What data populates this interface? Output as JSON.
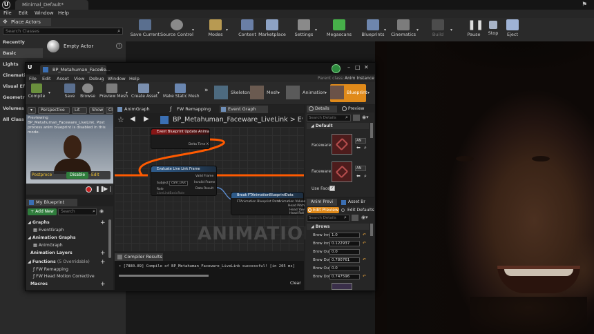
{
  "editor": {
    "level_tab": "Minimal_Default*",
    "menu": [
      "File",
      "Edit",
      "Window",
      "Help"
    ]
  },
  "place_actors": {
    "tab_label": "Place Actors",
    "search_placeholder": "Search Classes",
    "categories": [
      "Recently Placed",
      "Basic",
      "Lights",
      "Cinematic",
      "Visual Eff",
      "Geometry",
      "Volumes",
      "All Class"
    ],
    "selected_category": "Basic",
    "item_label": "Empty Actor"
  },
  "toolbar": {
    "buttons": [
      "Save Current",
      "Source Control",
      "Modes",
      "Content",
      "Marketplace",
      "Settings",
      "Megascans",
      "Blueprints",
      "Cinematics",
      "Build",
      "Pause",
      "Stop",
      "Eject"
    ]
  },
  "blueprint": {
    "tab_title": "BP_Metahuman_Facewe...",
    "menu": [
      "File",
      "Edit",
      "Asset",
      "View",
      "Debug",
      "Window",
      "Help"
    ],
    "parent_class_label": "Parent class:",
    "parent_class_value": "Anim Instance",
    "toolbar": {
      "buttons": [
        "Compile",
        "Save",
        "Browse",
        "Preview Mesh",
        "Create Asset",
        "Make Static Mesh"
      ],
      "modes": [
        "Skeleton",
        "Mesh",
        "Animation",
        "Blueprint"
      ],
      "more": "»"
    },
    "viewport": {
      "perspective": "Perspective",
      "lit": "Lit",
      "show": "Show",
      "overflow": "Cli",
      "warning": "Previewing BP_Metahuman_Faceware_LiveLink. Post process anim blueprint is disabled in this mode.",
      "postprocess": "Postproce",
      "disable": "Disable",
      "edit": "Edit"
    },
    "my_blueprint": {
      "tab_label": "My Blueprint",
      "add_new": "+ Add New",
      "search_placeholder": "Search",
      "sections": {
        "graphs": "Graphs",
        "event_graph": "EventGraph",
        "animation_graphs": "Animation Graphs",
        "anim_graph": "AnimGraph",
        "animation_layers": "Animation Layers",
        "functions": "Functions",
        "functions_overridable": "(5 Overridable)",
        "fn_1": "FW Remapping",
        "fn_2": "FW Head Motion Corrective",
        "macros": "Macros"
      }
    },
    "graph_tabs": [
      "AnimGraph",
      "FW Remapping",
      "Event Graph"
    ],
    "breadcrumb": "BP_Metahuman_Faceware_LiveLink  >  Event Graph",
    "nodes": {
      "n1_title": "Event Blueprint Update Animation",
      "n1_pin": "Delta Time X",
      "n2_title": "Evaluate Live Link Frame",
      "n2_pin_subject": "Subject",
      "n2_subject_value": "cam_ulvs",
      "n2_pin_role": "Role",
      "n2_role_value": "LiveLinkBasicRole",
      "n2_out_valid": "Valid Frame",
      "n2_out_invalid": "Invalid Frame",
      "n2_out_data": "Data Result",
      "n3_title": "Break FTAnimationBlueprintData",
      "n3_in": "FTAnimation Blueprint Data",
      "n3_out_1": "Animation Values",
      "n3_out_2": "Head Pitch",
      "n3_out_3": "Head Yaw",
      "n3_out_4": "Head Roll"
    },
    "watermark": "ANIMATION",
    "compiler": {
      "tab_label": "Compiler Results",
      "message": "• [7880.89] Compile of BP_Metahuman_Faceware_LiveLink successful! [in 205 ms]",
      "clear": "Clear"
    },
    "details": {
      "tab_label": "Details",
      "preview_tab": "Preview",
      "search_placeholder": "Search Details",
      "default_section": "Default",
      "faceware_label_1": "Faceware",
      "faceware_label_2": "Faceware",
      "combo_1": "AN",
      "combo_2": "AN",
      "use_face": "Use Face"
    },
    "anim_preview": {
      "tab_label": "Anim Previ",
      "asset_browser_tab": "Asset Br",
      "edit_preview": "Edit Preview",
      "edit_defaults": "Edit Defaults",
      "search_placeholder": "Search Details",
      "section": "Brows",
      "rows": [
        {
          "label": "Brow Inn",
          "value": "1.0"
        },
        {
          "label": "Brow Inn",
          "value": "0.122937"
        },
        {
          "label": "Brow Out",
          "value": "0.0"
        },
        {
          "label": "Brow Dow",
          "value": "0.780761"
        },
        {
          "label": "Brow Out",
          "value": "0.0"
        },
        {
          "label": "Brow Dow",
          "value": "0.747596"
        }
      ]
    }
  },
  "colors": {
    "accent_orange": "#e08a1a",
    "wire_orange": "#ff5a00",
    "compile_green": "#2f7d3c"
  }
}
